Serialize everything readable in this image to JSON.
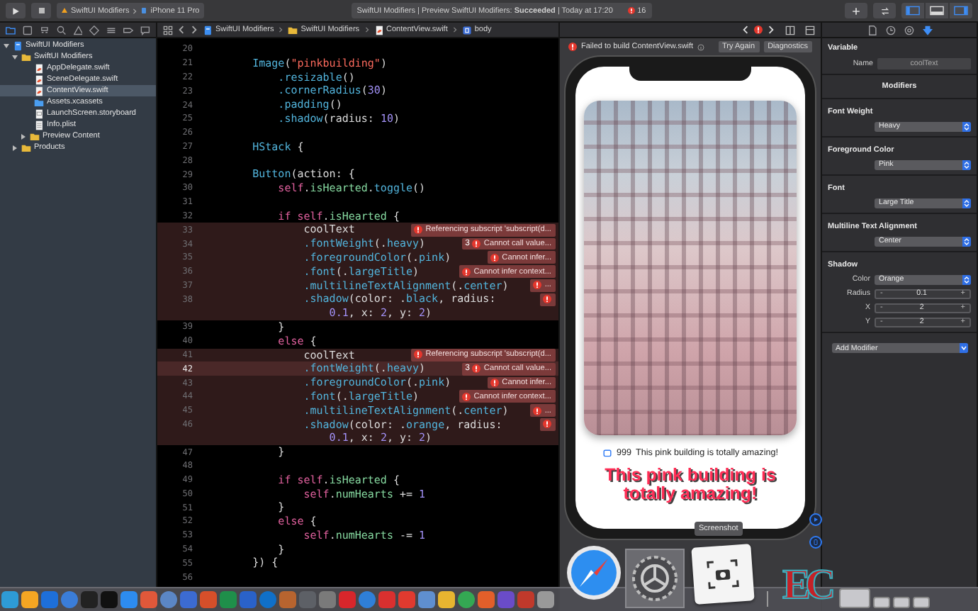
{
  "toolbar": {
    "scheme": "SwiftUI Modifiers",
    "device": "iPhone 11 Pro",
    "activity": "SwiftUI Modifiers | Preview SwiftUI Modifiers: **Succeeded** | Today at 17:20",
    "error_count": "16",
    "layout_buttons": [
      {
        "kind": "navigator",
        "on": true
      },
      {
        "kind": "debug",
        "on": false
      },
      {
        "kind": "inspector",
        "on": true
      }
    ]
  },
  "navigator_tabs": [
    {
      "kind": "folder",
      "selected": true
    },
    {
      "kind": "source-control",
      "selected": false
    },
    {
      "kind": "symbols",
      "selected": false
    },
    {
      "kind": "search",
      "selected": false
    },
    {
      "kind": "issues",
      "selected": false
    },
    {
      "kind": "tests",
      "selected": false
    },
    {
      "kind": "debug",
      "selected": false
    },
    {
      "kind": "breakpoints",
      "selected": false
    },
    {
      "kind": "reports",
      "selected": false
    }
  ],
  "tree": [
    {
      "label": "SwiftUI Modifiers",
      "kind": "project",
      "expanded": true,
      "selected": false,
      "children": [
        {
          "label": "SwiftUI Modifiers",
          "kind": "folder",
          "expanded": true,
          "selected": false,
          "children": [
            {
              "label": "AppDelegate.swift",
              "kind": "swift",
              "selected": false
            },
            {
              "label": "SceneDelegate.swift",
              "kind": "swift",
              "selected": false
            },
            {
              "label": "ContentView.swift",
              "kind": "swift",
              "selected": true
            },
            {
              "label": "Assets.xcassets",
              "kind": "assets",
              "selected": false
            },
            {
              "label": "LaunchScreen.storyboard",
              "kind": "storyboard",
              "selected": false
            },
            {
              "label": "Info.plist",
              "kind": "plist",
              "selected": false
            },
            {
              "label": "Preview Content",
              "kind": "folder",
              "expanded": false,
              "selected": false
            }
          ]
        },
        {
          "label": "Products",
          "kind": "folder",
          "expanded": false,
          "selected": false
        }
      ]
    }
  ],
  "breadcrumb": [
    {
      "kind": "project",
      "label": "SwiftUI Modifiers"
    },
    {
      "kind": "folder",
      "label": "SwiftUI Modifiers"
    },
    {
      "kind": "swift",
      "label": "ContentView.swift"
    },
    {
      "kind": "property",
      "label": "body"
    }
  ],
  "editor": {
    "lines": [
      {
        "number": "20",
        "error": false,
        "current": false
      },
      {
        "number": "21",
        "error": false,
        "current": false,
        "segments": [
          {
            "text": "        Image",
            "kind": "fn"
          },
          {
            "text": "(",
            "kind": "plain"
          },
          {
            "text": "\"pinkbuilding\"",
            "kind": "str"
          },
          {
            "text": ")",
            "kind": "plain"
          }
        ]
      },
      {
        "number": "22",
        "error": false,
        "current": false,
        "segments": [
          {
            "text": "            .resizable",
            "kind": "fn"
          },
          {
            "text": "()",
            "kind": "plain"
          }
        ]
      },
      {
        "number": "23",
        "error": false,
        "current": false,
        "segments": [
          {
            "text": "            .cornerRadius",
            "kind": "fn"
          },
          {
            "text": "(",
            "kind": "plain"
          },
          {
            "text": "30",
            "kind": "num"
          },
          {
            "text": ")",
            "kind": "plain"
          }
        ]
      },
      {
        "number": "24",
        "error": false,
        "current": false,
        "segments": [
          {
            "text": "            .padding",
            "kind": "fn"
          },
          {
            "text": "()",
            "kind": "plain"
          }
        ]
      },
      {
        "number": "25",
        "error": false,
        "current": false,
        "segments": [
          {
            "text": "            .shadow",
            "kind": "fn"
          },
          {
            "text": "(radius: ",
            "kind": "plain"
          },
          {
            "text": "10",
            "kind": "num"
          },
          {
            "text": ")",
            "kind": "plain"
          }
        ]
      },
      {
        "number": "26",
        "error": false,
        "current": false
      },
      {
        "number": "27",
        "error": false,
        "current": false,
        "segments": [
          {
            "text": "        HStack",
            "kind": "fn"
          },
          {
            "text": " {",
            "kind": "plain"
          }
        ]
      },
      {
        "number": "28",
        "error": false,
        "current": false
      },
      {
        "number": "29",
        "error": false,
        "current": false,
        "segments": [
          {
            "text": "        Button",
            "kind": "fn"
          },
          {
            "text": "(action: {",
            "kind": "plain"
          }
        ]
      },
      {
        "number": "30",
        "error": false,
        "current": false,
        "segments": [
          {
            "text": "            self",
            "kind": "kw"
          },
          {
            "text": ".",
            "kind": "plain"
          },
          {
            "text": "isHearted",
            "kind": "var"
          },
          {
            "text": ".",
            "kind": "plain"
          },
          {
            "text": "toggle",
            "kind": "fn"
          },
          {
            "text": "()",
            "kind": "plain"
          }
        ]
      },
      {
        "number": "31",
        "error": false,
        "current": false
      },
      {
        "number": "32",
        "error": false,
        "current": false,
        "segments": [
          {
            "text": "            if self",
            "kind": "kw"
          },
          {
            "text": ".",
            "kind": "plain"
          },
          {
            "text": "isHearted",
            "kind": "var"
          },
          {
            "text": " {",
            "kind": "plain"
          }
        ]
      },
      {
        "number": "33",
        "error": true,
        "current": false,
        "error_message": "Referencing subscript 'subscript(d...",
        "segments": [
          {
            "text": "                coolText",
            "kind": "plain"
          }
        ]
      },
      {
        "number": "34",
        "error": true,
        "current": false,
        "error_count": "3",
        "error_message": "Cannot call value...",
        "segments": [
          {
            "text": "                .fontWeight",
            "kind": "fn"
          },
          {
            "text": "(.",
            "kind": "plain"
          },
          {
            "text": "heavy",
            "kind": "fn"
          },
          {
            "text": ")",
            "kind": "plain"
          }
        ]
      },
      {
        "number": "35",
        "error": true,
        "current": false,
        "error_message": "Cannot infer...",
        "segments": [
          {
            "text": "                .foregroundColor",
            "kind": "fn"
          },
          {
            "text": "(.",
            "kind": "plain"
          },
          {
            "text": "pink",
            "kind": "fn"
          },
          {
            "text": ")",
            "kind": "plain"
          }
        ]
      },
      {
        "number": "36",
        "error": true,
        "current": false,
        "error_message": "Cannot infer context...",
        "segments": [
          {
            "text": "                .font",
            "kind": "fn"
          },
          {
            "text": "(.",
            "kind": "plain"
          },
          {
            "text": "largeTitle",
            "kind": "fn"
          },
          {
            "text": ")",
            "kind": "plain"
          }
        ]
      },
      {
        "number": "37",
        "error": true,
        "current": false,
        "error_message": "...",
        "segments": [
          {
            "text": "                .multilineTextAlignment",
            "kind": "fn"
          },
          {
            "text": "(.",
            "kind": "plain"
          },
          {
            "text": "center",
            "kind": "fn"
          },
          {
            "text": ")",
            "kind": "plain"
          }
        ]
      },
      {
        "number": "38",
        "error": true,
        "current": false,
        "segments": [
          {
            "text": "                .shadow",
            "kind": "fn"
          },
          {
            "text": "(color: .",
            "kind": "plain"
          },
          {
            "text": "black",
            "kind": "fn"
          },
          {
            "text": ", radius:",
            "kind": "plain"
          }
        ],
        "continuation": [
          {
            "text": "                    0.1",
            "kind": "num"
          },
          {
            "text": ", x: ",
            "kind": "plain"
          },
          {
            "text": "2",
            "kind": "num"
          },
          {
            "text": ", y: ",
            "kind": "plain"
          },
          {
            "text": "2",
            "kind": "num"
          },
          {
            "text": ")",
            "kind": "plain"
          }
        ]
      },
      {
        "number": "39",
        "error": false,
        "current": false,
        "segments": [
          {
            "text": "            }",
            "kind": "plain"
          }
        ]
      },
      {
        "number": "40",
        "error": false,
        "current": false,
        "segments": [
          {
            "text": "            else",
            "kind": "kw"
          },
          {
            "text": " {",
            "kind": "plain"
          }
        ]
      },
      {
        "number": "41",
        "error": true,
        "current": false,
        "error_message": "Referencing subscript 'subscript(d...",
        "segments": [
          {
            "text": "                coolText",
            "kind": "plain"
          }
        ]
      },
      {
        "number": "42",
        "error": true,
        "current": true,
        "error_count": "3",
        "error_message": "Cannot call value...",
        "segments": [
          {
            "text": "                .fontWeight",
            "kind": "fn"
          },
          {
            "text": "(.",
            "kind": "plain"
          },
          {
            "text": "heavy",
            "kind": "fn"
          },
          {
            "text": ")",
            "kind": "plain"
          }
        ]
      },
      {
        "number": "43",
        "error": true,
        "current": false,
        "error_message": "Cannot infer...",
        "segments": [
          {
            "text": "                .foregroundColor",
            "kind": "fn"
          },
          {
            "text": "(.",
            "kind": "plain"
          },
          {
            "text": "pink",
            "kind": "fn"
          },
          {
            "text": ")",
            "kind": "plain"
          }
        ]
      },
      {
        "number": "44",
        "error": true,
        "current": false,
        "error_message": "Cannot infer context...",
        "segments": [
          {
            "text": "                .font",
            "kind": "fn"
          },
          {
            "text": "(.",
            "kind": "plain"
          },
          {
            "text": "largeTitle",
            "kind": "fn"
          },
          {
            "text": ")",
            "kind": "plain"
          }
        ]
      },
      {
        "number": "45",
        "error": true,
        "current": false,
        "error_message": "...",
        "segments": [
          {
            "text": "                .multilineTextAlignment",
            "kind": "fn"
          },
          {
            "text": "(.",
            "kind": "plain"
          },
          {
            "text": "center",
            "kind": "fn"
          },
          {
            "text": ")",
            "kind": "plain"
          }
        ]
      },
      {
        "number": "46",
        "error": true,
        "current": false,
        "segments": [
          {
            "text": "                .shadow",
            "kind": "fn"
          },
          {
            "text": "(color: .",
            "kind": "plain"
          },
          {
            "text": "orange",
            "kind": "fn"
          },
          {
            "text": ", radius:",
            "kind": "plain"
          }
        ],
        "continuation": [
          {
            "text": "                    0.1",
            "kind": "num"
          },
          {
            "text": ", x: ",
            "kind": "plain"
          },
          {
            "text": "2",
            "kind": "num"
          },
          {
            "text": ", y: ",
            "kind": "plain"
          },
          {
            "text": "2",
            "kind": "num"
          },
          {
            "text": ")",
            "kind": "plain"
          }
        ]
      },
      {
        "number": "47",
        "error": false,
        "current": false,
        "segments": [
          {
            "text": "            }",
            "kind": "plain"
          }
        ]
      },
      {
        "number": "48",
        "error": false,
        "current": false
      },
      {
        "number": "49",
        "error": false,
        "current": false,
        "segments": [
          {
            "text": "            if self",
            "kind": "kw"
          },
          {
            "text": ".",
            "kind": "plain"
          },
          {
            "text": "isHearted",
            "kind": "var"
          },
          {
            "text": " {",
            "kind": "plain"
          }
        ]
      },
      {
        "number": "50",
        "error": false,
        "current": false,
        "segments": [
          {
            "text": "                self",
            "kind": "kw"
          },
          {
            "text": ".",
            "kind": "plain"
          },
          {
            "text": "numHearts",
            "kind": "var"
          },
          {
            "text": " += ",
            "kind": "plain"
          },
          {
            "text": "1",
            "kind": "num"
          }
        ]
      },
      {
        "number": "51",
        "error": false,
        "current": false,
        "segments": [
          {
            "text": "            }",
            "kind": "plain"
          }
        ]
      },
      {
        "number": "52",
        "error": false,
        "current": false,
        "segments": [
          {
            "text": "            else",
            "kind": "kw"
          },
          {
            "text": " {",
            "kind": "plain"
          }
        ]
      },
      {
        "number": "53",
        "error": false,
        "current": false,
        "segments": [
          {
            "text": "                self",
            "kind": "kw"
          },
          {
            "text": ".",
            "kind": "plain"
          },
          {
            "text": "numHearts",
            "kind": "var"
          },
          {
            "text": " -= ",
            "kind": "plain"
          },
          {
            "text": "1",
            "kind": "num"
          }
        ]
      },
      {
        "number": "54",
        "error": false,
        "current": false,
        "segments": [
          {
            "text": "            }",
            "kind": "plain"
          }
        ]
      },
      {
        "number": "55",
        "error": false,
        "current": false,
        "segments": [
          {
            "text": "        }) {",
            "kind": "plain"
          }
        ]
      },
      {
        "number": "56",
        "error": false,
        "current": false
      }
    ]
  },
  "canvas": {
    "message": "Failed to build ContentView.swift",
    "buttons": [
      "Try Again",
      "Diagnostics"
    ],
    "preview": {
      "count": "999",
      "caption": "This pink building is totally amazing!",
      "title": "This pink building is totally amazing!"
    }
  },
  "inspector": {
    "tabs": [
      {
        "kind": "file",
        "selected": false
      },
      {
        "kind": "history",
        "selected": false
      },
      {
        "kind": "help",
        "selected": false
      },
      {
        "kind": "attributes",
        "selected": true
      }
    ],
    "title": "Variable",
    "name_label": "Name",
    "name_value": "coolText",
    "modifiers_title": "Modifiers",
    "groups": [
      {
        "title": "Font Weight",
        "rows": [
          {
            "kind": "popup",
            "value": "Heavy"
          }
        ]
      },
      {
        "title": "Foreground Color",
        "rows": [
          {
            "kind": "popup",
            "value": "Pink"
          }
        ]
      },
      {
        "title": "Font",
        "rows": [
          {
            "kind": "popup",
            "value": "Large Title"
          }
        ]
      },
      {
        "title": "Multiline Text Alignment",
        "rows": [
          {
            "kind": "popup",
            "value": "Center"
          }
        ]
      },
      {
        "title": "Shadow",
        "rows": [
          {
            "kind": "popup",
            "label": "Color",
            "value": "Orange"
          },
          {
            "kind": "stepper",
            "label": "Radius",
            "value": "0.1",
            "decrement": "-",
            "increment": "+"
          },
          {
            "kind": "stepper",
            "label": "X",
            "value": "2",
            "decrement": "-",
            "increment": "+"
          },
          {
            "kind": "stepper",
            "label": "Y",
            "value": "2",
            "decrement": "-",
            "increment": "+"
          }
        ]
      }
    ],
    "add_modifier": "Add Modifier"
  },
  "dock": {
    "tooltip": "Screenshot",
    "logo": "EC"
  }
}
